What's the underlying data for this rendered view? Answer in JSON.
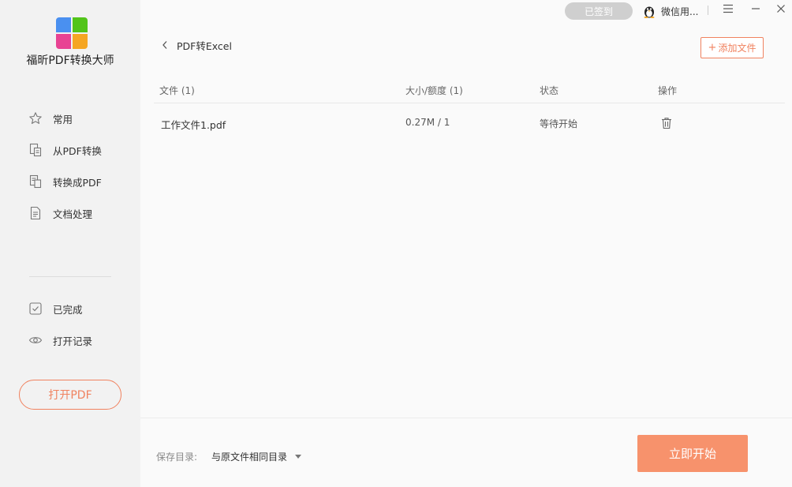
{
  "app": {
    "title": "福昕PDF转换大师"
  },
  "sidebar": {
    "items": [
      {
        "label": "常用",
        "icon": "star-icon"
      },
      {
        "label": "从PDF转换",
        "icon": "from-pdf-icon"
      },
      {
        "label": "转换成PDF",
        "icon": "to-pdf-icon"
      },
      {
        "label": "文档处理",
        "icon": "document-icon"
      }
    ],
    "secondary": [
      {
        "label": "已完成",
        "icon": "checked-box-icon"
      },
      {
        "label": "打开记录",
        "icon": "eye-icon"
      }
    ],
    "open_pdf_label": "打开PDF"
  },
  "topbar": {
    "checkin_label": "已签到",
    "user_name": "微信用...",
    "menu_icon": "hamburger-icon",
    "minimize_icon": "minimize-icon",
    "close_icon": "close-icon"
  },
  "page": {
    "title": "PDF转Excel",
    "add_file_label": "添加文件",
    "add_file_prefix": "+"
  },
  "table": {
    "headers": {
      "file": "文件 (1)",
      "size": "大小/额度 (1)",
      "status": "状态",
      "action": "操作"
    },
    "rows": [
      {
        "name": "工作文件1.pdf",
        "size": "0.27M / 1",
        "status": "等待开始",
        "action_icon": "trash-icon"
      }
    ]
  },
  "bottom": {
    "save_label": "保存目录:",
    "save_value": "与原文件相同目录",
    "start_label": "立即开始"
  },
  "colors": {
    "accent": "#f0825f",
    "start_button": "#f7926c",
    "sidebar_bg": "#f2f2f2",
    "checkin_bg": "#cfcfcf"
  }
}
